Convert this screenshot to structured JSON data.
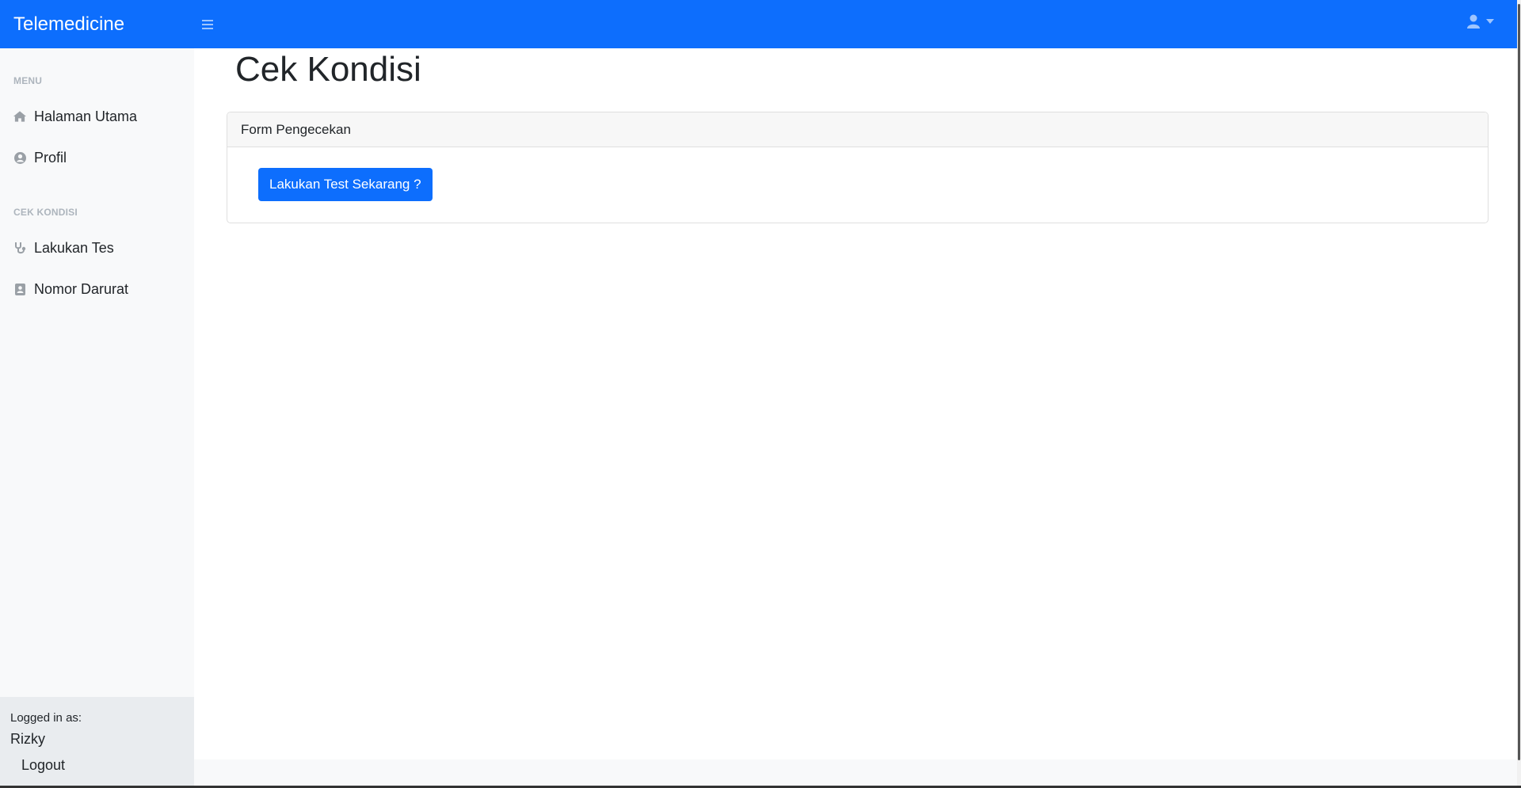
{
  "topnav": {
    "brand": "Telemedicine",
    "bg_color": "#0d6efd",
    "toggle_icon": "hamburger-icon",
    "user_icon": "user-icon"
  },
  "sidebar": {
    "sections": [
      {
        "heading": "MENU",
        "items": [
          {
            "label": "Halaman Utama",
            "icon": "home-icon"
          },
          {
            "label": "Profil",
            "icon": "user-circle-icon"
          }
        ]
      },
      {
        "heading": "CEK KONDISI",
        "items": [
          {
            "label": "Lakukan Tes",
            "icon": "stethoscope-icon"
          },
          {
            "label": "Nomor Darurat",
            "icon": "address-book-icon"
          }
        ]
      }
    ],
    "footer": {
      "logged_label": "Logged in as:",
      "username": "Rizky",
      "logout": "Logout"
    }
  },
  "main": {
    "title": "Cek Kondisi",
    "card": {
      "header": "Form Pengecekan",
      "button": "Lakukan Test Sekarang ?"
    }
  }
}
